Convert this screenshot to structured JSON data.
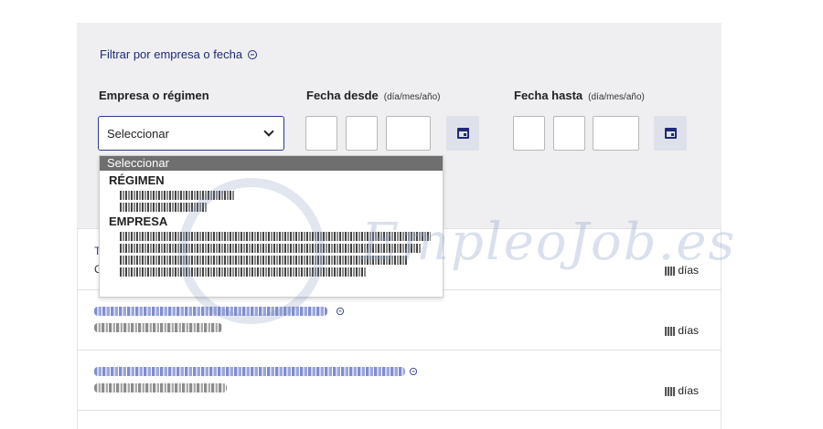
{
  "filter": {
    "toggle_label": "Filtrar por empresa o fecha",
    "empresa_label": "Empresa o régimen",
    "fecha_desde_label": "Fecha desde",
    "fecha_hasta_label": "Fecha hasta",
    "date_hint": "(día/mes/año)",
    "select_value": "Seleccionar"
  },
  "dropdown": {
    "selected": "Seleccionar",
    "groups": [
      {
        "label": "RÉGIMEN"
      },
      {
        "label": "EMPRESA"
      }
    ]
  },
  "results": {
    "rows": [
      {
        "partial_text": "T",
        "partial_text_2": "C",
        "days": "días"
      },
      {
        "days": "días"
      },
      {
        "days": "días"
      }
    ]
  },
  "watermark": {
    "text": "EmpleoJob.es"
  },
  "colors": {
    "accent": "#1f2a78",
    "panel": "#efeff1",
    "select_border": "#2c3a8c"
  }
}
